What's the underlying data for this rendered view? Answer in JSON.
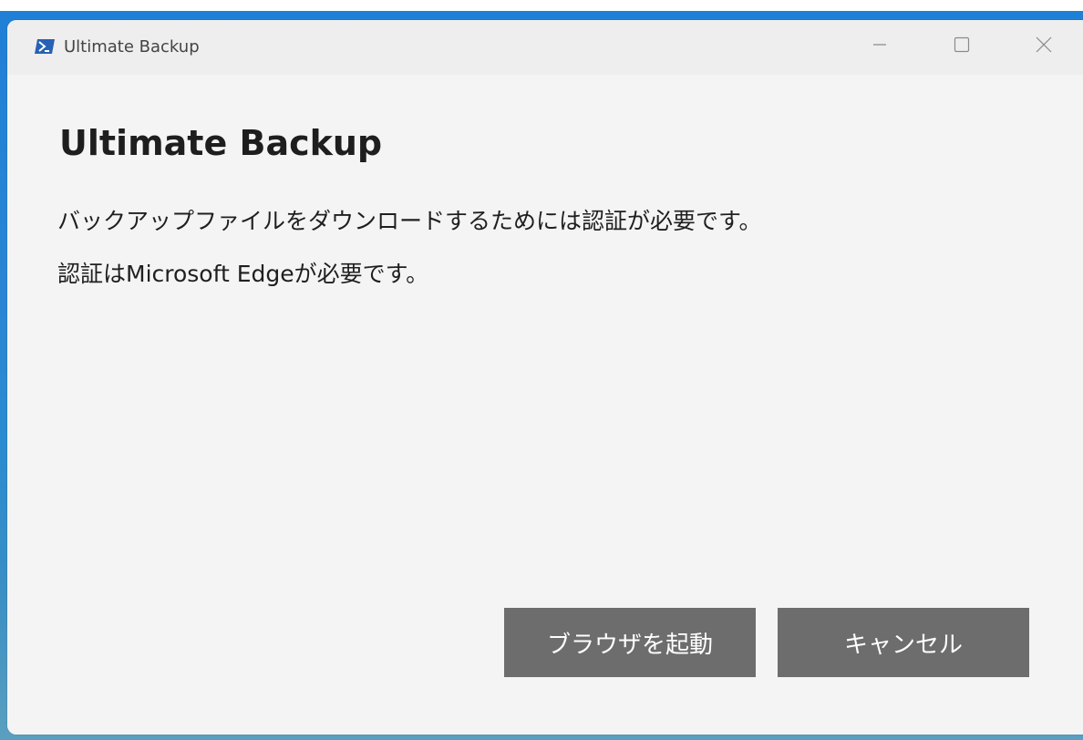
{
  "window": {
    "title": "Ultimate Backup",
    "icon": "powershell-icon",
    "controls": [
      "minimize-icon",
      "maximize-icon",
      "close-icon"
    ]
  },
  "content": {
    "heading": "Ultimate Backup",
    "message_line1": "バックアップファイルをダウンロードするためには認証が必要です。",
    "message_line2": "認証はMicrosoft Edgeが必要です。"
  },
  "buttons": {
    "launch_browser": "ブラウザを起動",
    "cancel": "キャンセル"
  },
  "colors": {
    "button_bg": "#6d6d6d",
    "button_text": "#ffffff",
    "icon_blue": "#2662b5",
    "window_bg": "#f4f4f4"
  }
}
